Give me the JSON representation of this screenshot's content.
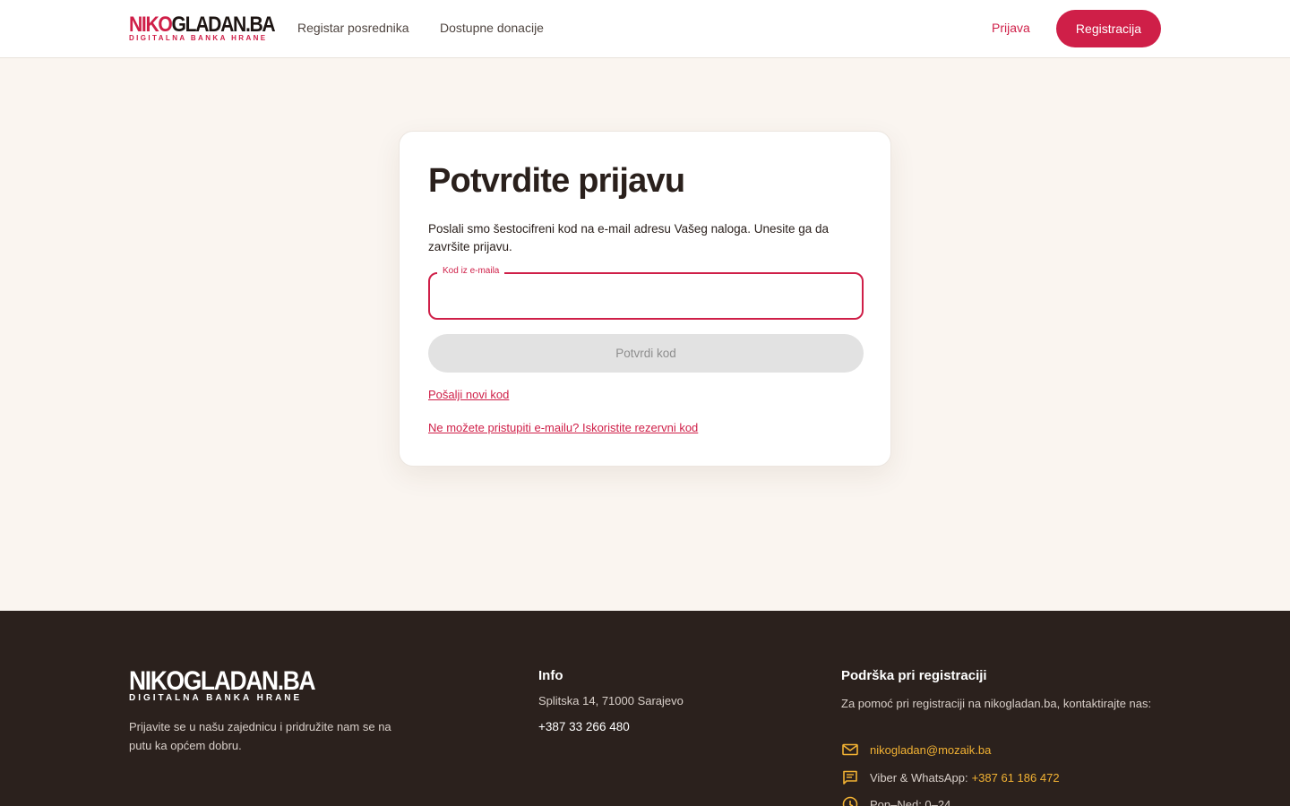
{
  "header": {
    "logo_main_red": "NIKO",
    "logo_main_dark": "GLADAN.BA",
    "logo_sub": "DIGITALNA BANKA HRANE",
    "nav": [
      {
        "label": "Registar posrednika"
      },
      {
        "label": "Dostupne donacije"
      }
    ],
    "login_label": "Prijava",
    "register_label": "Registracija"
  },
  "card": {
    "title": "Potvrdite prijavu",
    "description": "Poslali smo šestocifreni kod na e-mail adresu Vašeg naloga. Unesite ga da završite prijavu.",
    "code_field_label": "Kod iz e-maila",
    "code_field_value": "",
    "confirm_label": "Potvrdi kod",
    "resend_label": "Pošalji novi kod",
    "backup_label": "Ne možete pristupiti e-mailu? Iskoristite rezervni kod"
  },
  "footer": {
    "logo_main": "NIKOGLADAN.BA",
    "logo_sub": "DIGITALNA BANKA HRANE",
    "tagline": "Prijavite se u našu zajednicu i pridružite nam se na putu ka općem dobru.",
    "info_heading": "Info",
    "address": "Splitska 14, 71000 Sarajevo",
    "phone": "+387 33 266 480",
    "support_heading": "Podrška pri registraciji",
    "support_text": "Za pomoć pri registraciji na nikogladan.ba, kontaktirajte nas:",
    "email": "nikogladan@mozaik.ba",
    "viber_label": "Viber & WhatsApp:",
    "viber_number": "+387 61 186 472",
    "hours": "Pon–Ned: 0–24"
  },
  "colors": {
    "brand_red": "#cf1f48",
    "footer_bg": "#2b211d",
    "accent_yellow": "#f2b233",
    "page_bg": "#faf5f0"
  },
  "icons": [
    "mail-icon",
    "chat-icon",
    "clock-icon"
  ]
}
